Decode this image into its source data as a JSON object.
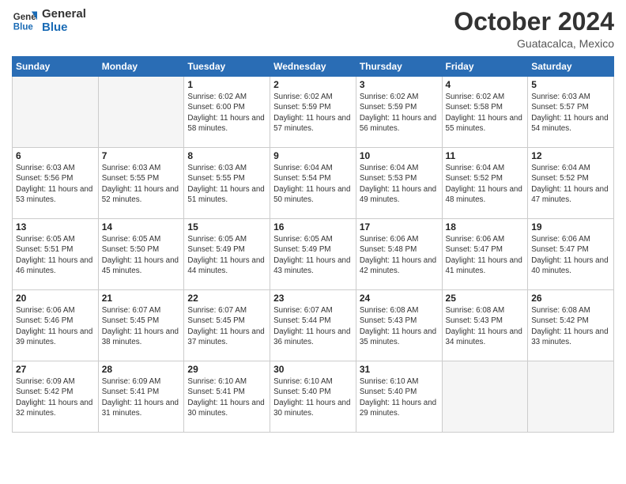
{
  "header": {
    "logo_line1": "General",
    "logo_line2": "Blue",
    "month_year": "October 2024",
    "location": "Guatacalca, Mexico"
  },
  "weekdays": [
    "Sunday",
    "Monday",
    "Tuesday",
    "Wednesday",
    "Thursday",
    "Friday",
    "Saturday"
  ],
  "weeks": [
    [
      {
        "day": "",
        "info": ""
      },
      {
        "day": "",
        "info": ""
      },
      {
        "day": "1",
        "info": "Sunrise: 6:02 AM\nSunset: 6:00 PM\nDaylight: 11 hours and 58 minutes."
      },
      {
        "day": "2",
        "info": "Sunrise: 6:02 AM\nSunset: 5:59 PM\nDaylight: 11 hours and 57 minutes."
      },
      {
        "day": "3",
        "info": "Sunrise: 6:02 AM\nSunset: 5:59 PM\nDaylight: 11 hours and 56 minutes."
      },
      {
        "day": "4",
        "info": "Sunrise: 6:02 AM\nSunset: 5:58 PM\nDaylight: 11 hours and 55 minutes."
      },
      {
        "day": "5",
        "info": "Sunrise: 6:03 AM\nSunset: 5:57 PM\nDaylight: 11 hours and 54 minutes."
      }
    ],
    [
      {
        "day": "6",
        "info": "Sunrise: 6:03 AM\nSunset: 5:56 PM\nDaylight: 11 hours and 53 minutes."
      },
      {
        "day": "7",
        "info": "Sunrise: 6:03 AM\nSunset: 5:55 PM\nDaylight: 11 hours and 52 minutes."
      },
      {
        "day": "8",
        "info": "Sunrise: 6:03 AM\nSunset: 5:55 PM\nDaylight: 11 hours and 51 minutes."
      },
      {
        "day": "9",
        "info": "Sunrise: 6:04 AM\nSunset: 5:54 PM\nDaylight: 11 hours and 50 minutes."
      },
      {
        "day": "10",
        "info": "Sunrise: 6:04 AM\nSunset: 5:53 PM\nDaylight: 11 hours and 49 minutes."
      },
      {
        "day": "11",
        "info": "Sunrise: 6:04 AM\nSunset: 5:52 PM\nDaylight: 11 hours and 48 minutes."
      },
      {
        "day": "12",
        "info": "Sunrise: 6:04 AM\nSunset: 5:52 PM\nDaylight: 11 hours and 47 minutes."
      }
    ],
    [
      {
        "day": "13",
        "info": "Sunrise: 6:05 AM\nSunset: 5:51 PM\nDaylight: 11 hours and 46 minutes."
      },
      {
        "day": "14",
        "info": "Sunrise: 6:05 AM\nSunset: 5:50 PM\nDaylight: 11 hours and 45 minutes."
      },
      {
        "day": "15",
        "info": "Sunrise: 6:05 AM\nSunset: 5:49 PM\nDaylight: 11 hours and 44 minutes."
      },
      {
        "day": "16",
        "info": "Sunrise: 6:05 AM\nSunset: 5:49 PM\nDaylight: 11 hours and 43 minutes."
      },
      {
        "day": "17",
        "info": "Sunrise: 6:06 AM\nSunset: 5:48 PM\nDaylight: 11 hours and 42 minutes."
      },
      {
        "day": "18",
        "info": "Sunrise: 6:06 AM\nSunset: 5:47 PM\nDaylight: 11 hours and 41 minutes."
      },
      {
        "day": "19",
        "info": "Sunrise: 6:06 AM\nSunset: 5:47 PM\nDaylight: 11 hours and 40 minutes."
      }
    ],
    [
      {
        "day": "20",
        "info": "Sunrise: 6:06 AM\nSunset: 5:46 PM\nDaylight: 11 hours and 39 minutes."
      },
      {
        "day": "21",
        "info": "Sunrise: 6:07 AM\nSunset: 5:45 PM\nDaylight: 11 hours and 38 minutes."
      },
      {
        "day": "22",
        "info": "Sunrise: 6:07 AM\nSunset: 5:45 PM\nDaylight: 11 hours and 37 minutes."
      },
      {
        "day": "23",
        "info": "Sunrise: 6:07 AM\nSunset: 5:44 PM\nDaylight: 11 hours and 36 minutes."
      },
      {
        "day": "24",
        "info": "Sunrise: 6:08 AM\nSunset: 5:43 PM\nDaylight: 11 hours and 35 minutes."
      },
      {
        "day": "25",
        "info": "Sunrise: 6:08 AM\nSunset: 5:43 PM\nDaylight: 11 hours and 34 minutes."
      },
      {
        "day": "26",
        "info": "Sunrise: 6:08 AM\nSunset: 5:42 PM\nDaylight: 11 hours and 33 minutes."
      }
    ],
    [
      {
        "day": "27",
        "info": "Sunrise: 6:09 AM\nSunset: 5:42 PM\nDaylight: 11 hours and 32 minutes."
      },
      {
        "day": "28",
        "info": "Sunrise: 6:09 AM\nSunset: 5:41 PM\nDaylight: 11 hours and 31 minutes."
      },
      {
        "day": "29",
        "info": "Sunrise: 6:10 AM\nSunset: 5:41 PM\nDaylight: 11 hours and 30 minutes."
      },
      {
        "day": "30",
        "info": "Sunrise: 6:10 AM\nSunset: 5:40 PM\nDaylight: 11 hours and 30 minutes."
      },
      {
        "day": "31",
        "info": "Sunrise: 6:10 AM\nSunset: 5:40 PM\nDaylight: 11 hours and 29 minutes."
      },
      {
        "day": "",
        "info": ""
      },
      {
        "day": "",
        "info": ""
      }
    ]
  ]
}
